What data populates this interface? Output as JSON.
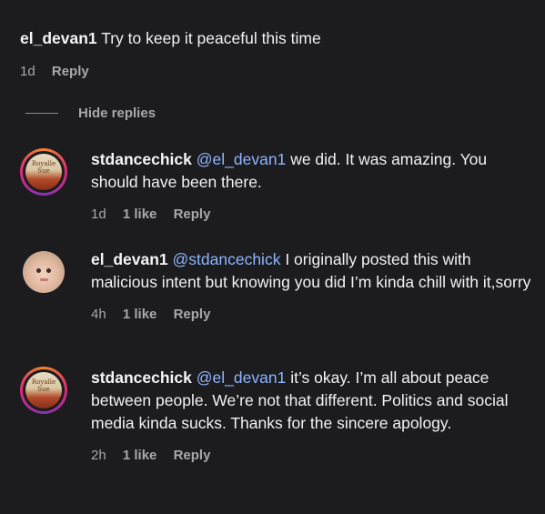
{
  "top_comment": {
    "username": "el_devan1",
    "text": "Try to keep it peaceful this time",
    "time": "1d",
    "reply_label": "Reply"
  },
  "hide_replies_label": "Hide replies",
  "replies": [
    {
      "username": "stdancechick",
      "mention": "@el_devan1",
      "text": "we did. It was amazing. You should have been there.",
      "time": "1d",
      "likes": "1 like",
      "reply_label": "Reply",
      "avatar": "book-cover-avatar",
      "has_story_ring": true
    },
    {
      "username": "el_devan1",
      "mention": "@stdancechick",
      "text": "I originally posted this with malicious intent but knowing you did I’m kinda chill with it,sorry",
      "time": "4h",
      "likes": "1 like",
      "reply_label": "Reply",
      "avatar": "baby-photo-avatar",
      "has_story_ring": false
    },
    {
      "username": "stdancechick",
      "mention": "@el_devan1",
      "text": "it’s okay. I’m all about peace between people. We’re not that different. Politics and social media kinda sucks. Thanks for the sincere apology.",
      "time": "2h",
      "likes": "1 like",
      "reply_label": "Reply",
      "avatar": "book-cover-avatar",
      "has_story_ring": true
    }
  ],
  "colors": {
    "background": "#1c1c1e",
    "mention": "#8eb4ff",
    "meta": "#a8a8a8"
  }
}
